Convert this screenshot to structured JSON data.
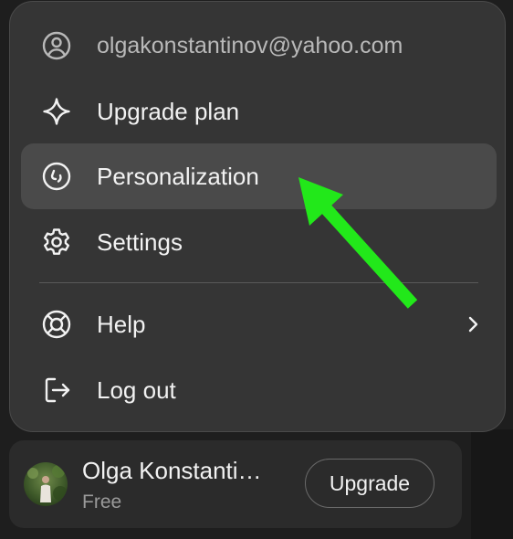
{
  "menu": {
    "email": "olgakonstantinov@yahoo.com",
    "items": [
      {
        "label": "Upgrade plan",
        "icon": "sparkle-icon"
      },
      {
        "label": "Personalization",
        "icon": "personalization-icon"
      },
      {
        "label": "Settings",
        "icon": "gear-icon"
      },
      {
        "label": "Help",
        "icon": "lifebuoy-icon"
      },
      {
        "label": "Log out",
        "icon": "logout-icon"
      }
    ]
  },
  "user": {
    "name": "Olga Konstanti…",
    "plan": "Free",
    "upgrade_label": "Upgrade"
  },
  "colors": {
    "menu_bg": "#353535",
    "highlight": "#4a4a4a",
    "annotation_arrow": "#22e81a"
  }
}
